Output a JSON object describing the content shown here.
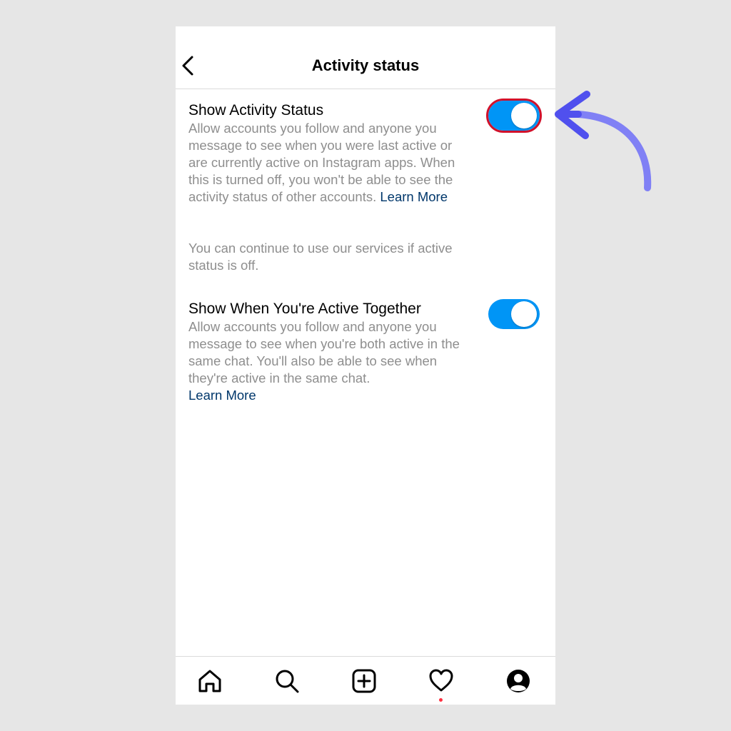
{
  "header": {
    "title": "Activity status"
  },
  "settings": {
    "activity_status": {
      "title": "Show Activity Status",
      "description": "Allow accounts you follow and anyone you message to see when you were last active or are currently active on Instagram apps. When this is turned off, you won't be able to see the activity status of other accounts.",
      "learn_more": "Learn More",
      "note": "You can continue to use our services if active status is off.",
      "enabled": true
    },
    "active_together": {
      "title": "Show When You're Active Together",
      "description": "Allow accounts you follow and anyone you message to see when you're both active in the same chat. You'll also be able to see when they're active in the same chat.",
      "learn_more": "Learn More",
      "enabled": true
    }
  },
  "tabbar": {
    "items": [
      "home-icon",
      "search-icon",
      "new-post-icon",
      "activity-heart-icon",
      "profile-icon"
    ]
  },
  "colors": {
    "toggle_on": "#0095f6",
    "link": "#00376b",
    "highlight": "#d0112b",
    "annotation_arrow": "#5b5bf0",
    "notification_dot": "#ff3040"
  }
}
